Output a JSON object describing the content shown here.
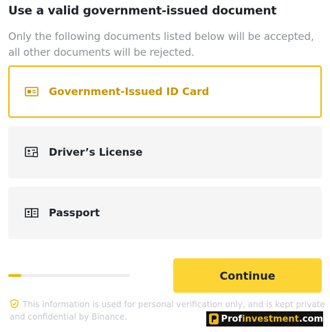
{
  "heading": "Use a valid government-issued document",
  "description": "Only the following documents listed below will be accepted, all other documents will be rejected.",
  "document_options": [
    {
      "label": "Government-Issued ID Card",
      "icon": "id-card-icon",
      "selected": true
    },
    {
      "label": "Driver’s License",
      "icon": "drivers-license-icon",
      "selected": false
    },
    {
      "label": "Passport",
      "icon": "passport-icon",
      "selected": false
    }
  ],
  "progress": {
    "fraction": 0.11
  },
  "continue_label": "Continue",
  "privacy_note": "This information is used for personal verification only, and is kept private and confidential by Binance.",
  "watermark": {
    "part1": "Prof",
    "part2": "investment",
    "part3": ".com"
  },
  "colors": {
    "accent": "#f0b90b",
    "button": "#fcd535",
    "selected_text": "#c99400",
    "option_bg": "#f5f5f5"
  }
}
